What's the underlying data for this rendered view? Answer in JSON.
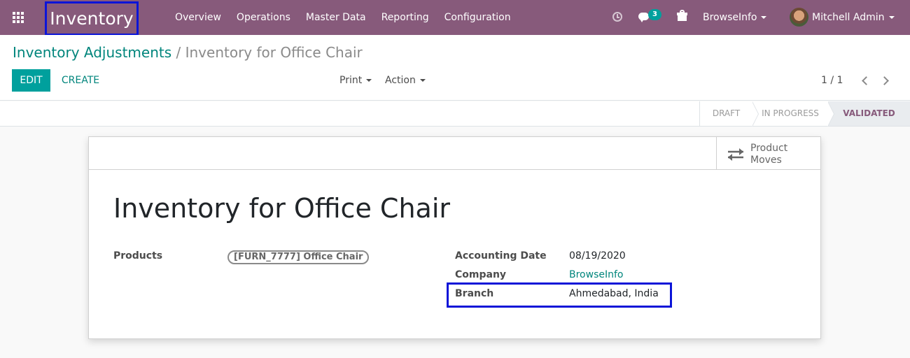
{
  "navbar": {
    "app_title": "Inventory",
    "menu": [
      "Overview",
      "Operations",
      "Master Data",
      "Reporting",
      "Configuration"
    ],
    "message_count": "3",
    "company": "BrowseInfo",
    "user": "Mitchell Admin",
    "bar_color": "#875a7b",
    "highlight_color": "#0b14d8"
  },
  "breadcrumb": {
    "parent": "Inventory Adjustments",
    "separator": "/",
    "current": "Inventory for Office Chair"
  },
  "buttons": {
    "edit": "EDIT",
    "create": "CREATE"
  },
  "dropdowns": {
    "print": "Print",
    "action": "Action"
  },
  "pager": "1 / 1",
  "stages": {
    "draft": "DRAFT",
    "in_progress": "IN PROGRESS",
    "validated": "VALIDATED",
    "current": "VALIDATED"
  },
  "smart_button": {
    "line1": "Product",
    "line2": "Moves",
    "icon": "exchange-arrows-icon"
  },
  "form": {
    "title": "Inventory for Office Chair",
    "products_label": "Products",
    "product_tag": "[FURN_7777] Office Chair",
    "accounting_date_label": "Accounting Date",
    "accounting_date": "08/19/2020",
    "company_label": "Company",
    "company": "BrowseInfo",
    "branch_label": "Branch",
    "branch": "Ahmedabad, India"
  },
  "accent_color": "#00a09d"
}
